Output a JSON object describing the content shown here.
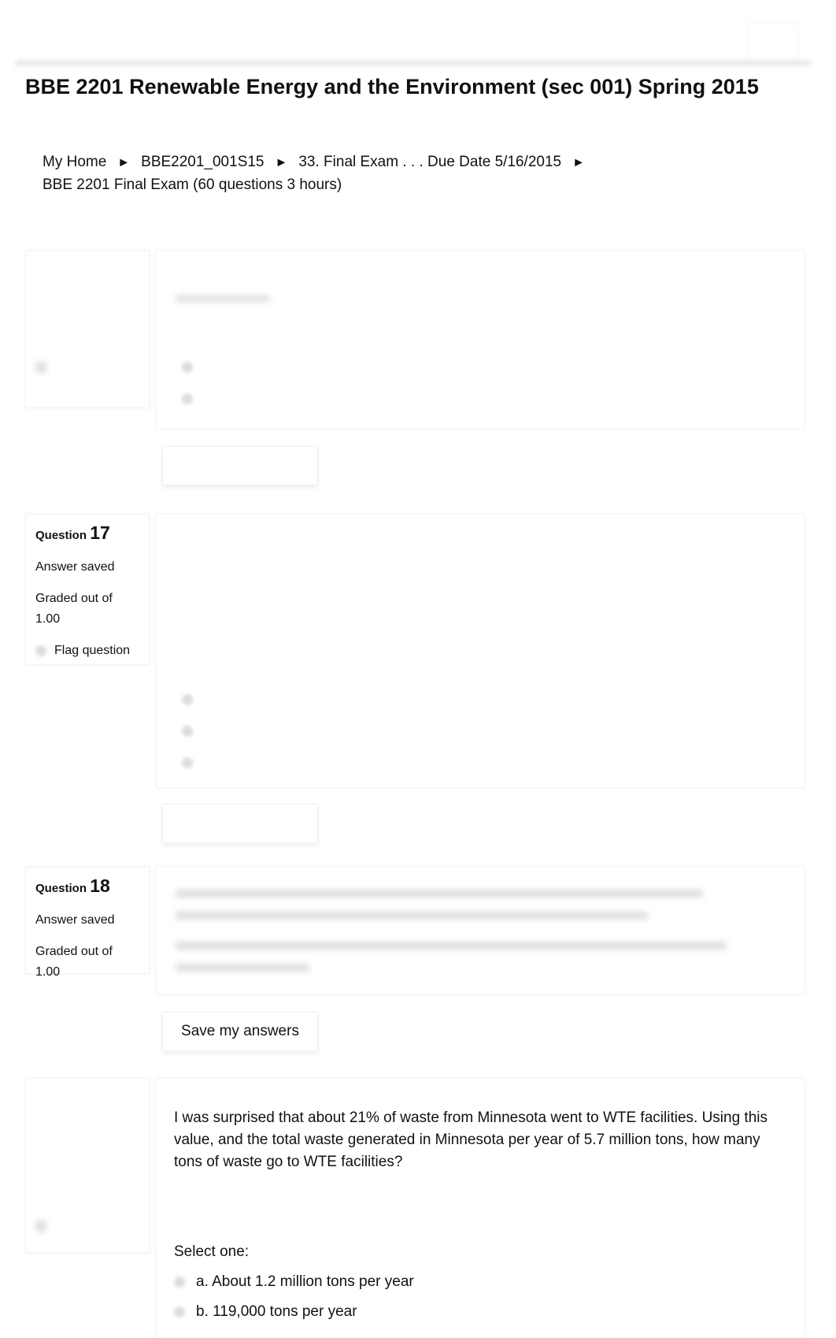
{
  "header": {
    "title": "BBE 2201 Renewable Energy and the Environment (sec 001) Spring 2015"
  },
  "breadcrumb": {
    "items": [
      "My Home",
      "BBE2201_001S15",
      "33. Final Exam . . . Due Date 5/16/2015",
      "BBE 2201 Final Exam (60 questions  3 hours)"
    ],
    "separator": "►"
  },
  "questions": [
    {
      "label": "Question",
      "number": "17",
      "status": "Answer saved",
      "graded": "Graded out of",
      "points": "1.00",
      "flag": "Flag question"
    },
    {
      "label": "Question",
      "number": "18",
      "status": "Answer saved",
      "graded": "Graded out of",
      "points": "1.00",
      "save_label": "Save my answers"
    },
    {
      "text": "I was surprised that about 21% of waste from Minnesota went to WTE facilities. Using this value, and the total waste generated in Minnesota per year of 5.7 million tons, how many tons of waste go to WTE facilities?",
      "prompt": "Select one:",
      "options": [
        "a. About 1.2 million tons per year",
        "b. 119,000 tons per year"
      ]
    }
  ]
}
